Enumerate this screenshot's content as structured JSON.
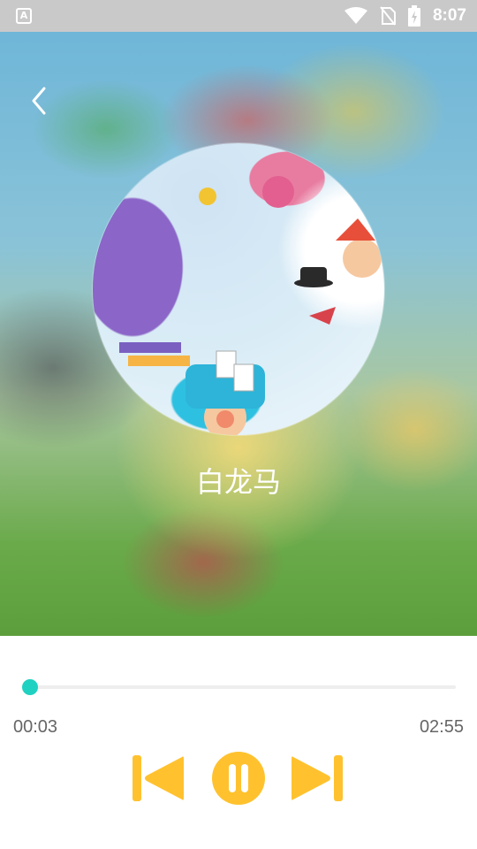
{
  "status_bar": {
    "app_badge": "A",
    "time": "8:07",
    "icons": [
      "wifi-icon",
      "no-sim-icon",
      "battery-charging-icon"
    ]
  },
  "player": {
    "song_title": "白龙马",
    "current_time": "00:03",
    "total_time": "02:55",
    "progress_fraction": 0.017,
    "accent_color": "#1fd1c0",
    "control_color": "#ffc22e",
    "controls": [
      "previous-icon",
      "pause-icon",
      "next-icon"
    ]
  }
}
